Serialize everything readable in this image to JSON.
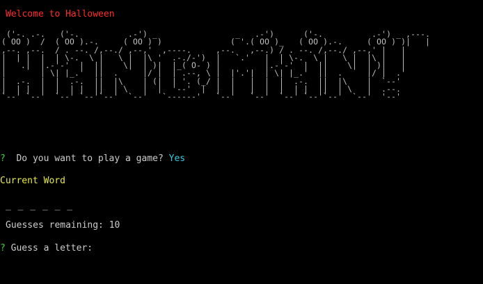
{
  "colors": {
    "background": "#000000",
    "default_text": "#cccccc",
    "welcome": "#ff2b2b",
    "prompt_marker": "#3fcf3f",
    "answer": "#38c8e0",
    "current_word": "#e8e84a"
  },
  "terminal": {
    "welcome": "Welcome to Halloween",
    "banner_lines": [
      " ('-. .-.   ('-.          .-') _                _   .-')      ('-.          .-') _ ,---. ",
      "( OO )  /  ( OO ).-.     ( OO ) )              ( '.( OO )_   ( OO ).-.     ( OO ) )|   | ",
      ",--. ,--.  / . --. /,--./ ,--,'  ,----.     ,--.   ,--.) / . --. /,--./ ,--,' |   | ",
      "|  | |  |  | \\-.  \\ |   \\ |  |\\ '  .-./-')  |   `.'   |  | \\-.  \\ |   \\ |  |\\ |   | ",
      "|   .|  |.-'-'  |  ||    \\|  | )|  |_( O- ) |         |.-'-'  |  ||    \\|  | )|   | ",
      "|       | \\| |_.'  ||  .     |/ |  | .--, \\ |  |'.'|  | \\| |_.'  ||  .     |/ |  .' ",
      "|  .-.  |  |  .-.  ||  |\\    | (|  | '. (_/ |  |   |  |  |  .-.  ||  |\\    |  `--'  ",
      "|  | |  |  |  | |  ||  | \\   |  |  '--'  |  |  |   |  |  |  | |  ||  | \\   |  .--.  ",
      "`--' `--'  `--' `--'`--'  `--'   `------'   `--'   `--'  `--' `--'`--'  `--'  '--'  "
    ],
    "play_prompt": {
      "marker": "?",
      "question": "  Do you want to play a game? ",
      "answer": "Yes"
    },
    "current_word_label": "Current Word",
    "word_blanks": "_ _ _ _ _ _",
    "guesses_line": "Guesses remaining: 10",
    "guess_prompt": {
      "marker": "?",
      "question": " Guess a letter:"
    }
  }
}
